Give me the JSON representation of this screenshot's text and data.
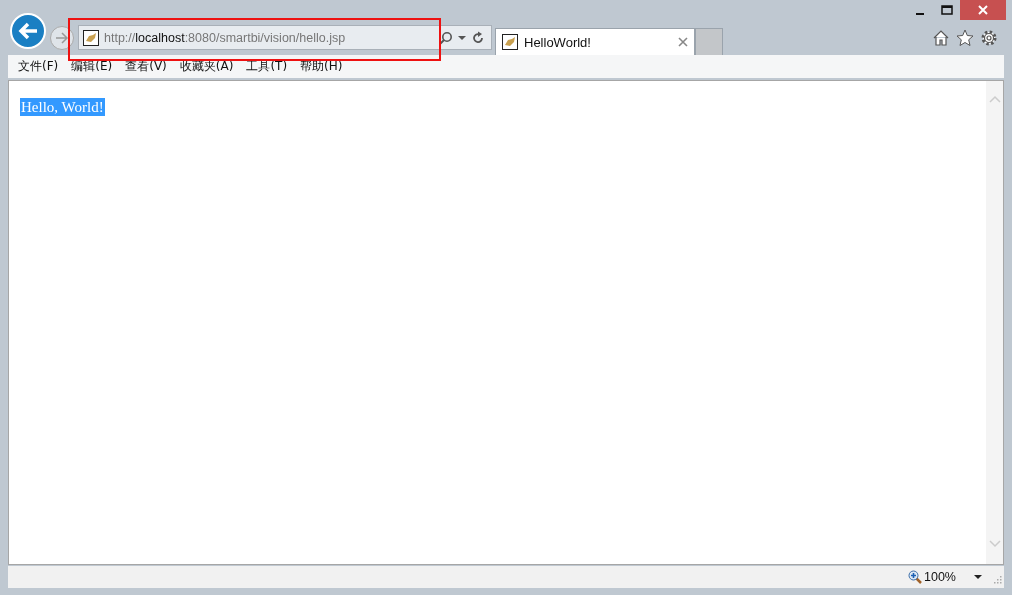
{
  "address_bar": {
    "url": "http://**localhost**:8080/smartbi/vision/hello.jsp",
    "highlighted": true
  },
  "tabs": [
    {
      "title": "HelloWorld!",
      "selected": true
    }
  ],
  "menu": [
    {
      "label": "文件(F)"
    },
    {
      "label": "编辑(E)"
    },
    {
      "label": "查看(V)"
    },
    {
      "label": "收藏夹(A)"
    },
    {
      "label": "工具(T)"
    },
    {
      "label": "帮助(H)"
    }
  ],
  "page": {
    "text": "Hello, World!",
    "selected": true
  },
  "status_bar": {
    "zoom": "100%"
  }
}
